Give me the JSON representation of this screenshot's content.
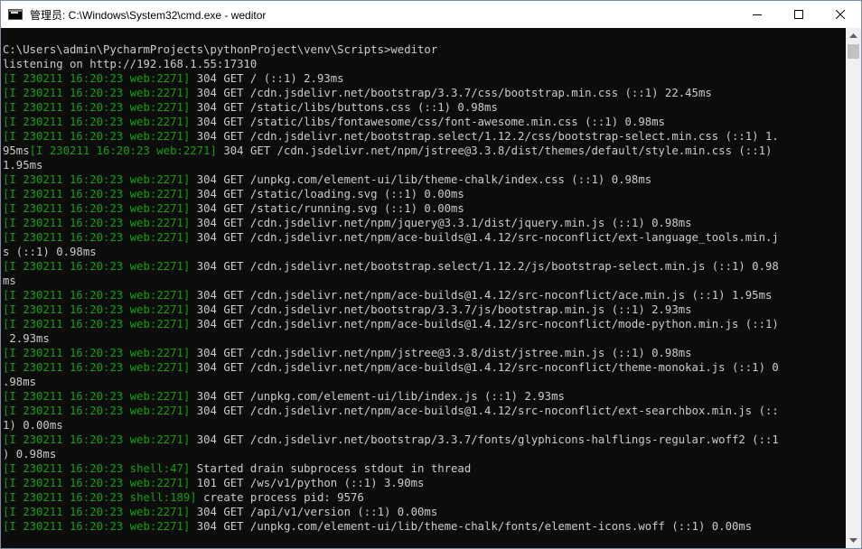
{
  "window": {
    "title": "管理员: C:\\Windows\\System32\\cmd.exe - weditor",
    "icon": "cmd-console-icon"
  },
  "console": {
    "lines": [
      [
        {
          "t": "C:\\Users\\admin\\PycharmProjects\\pythonProject\\venv\\Scripts>weditor"
        }
      ],
      [
        {
          "t": "listening on http://192.168.1.55:17310"
        }
      ],
      [
        {
          "t": "[I 230211 16:20:23 web:2271]",
          "g": true
        },
        {
          "t": " 304 GET / (::1) 2.93ms"
        }
      ],
      [
        {
          "t": "[I 230211 16:20:23 web:2271]",
          "g": true
        },
        {
          "t": " 304 GET /cdn.jsdelivr.net/bootstrap/3.3.7/css/bootstrap.min.css (::1) 22.45ms"
        }
      ],
      [
        {
          "t": "[I 230211 16:20:23 web:2271]",
          "g": true
        },
        {
          "t": " 304 GET /static/libs/buttons.css (::1) 0.98ms"
        }
      ],
      [
        {
          "t": "[I 230211 16:20:23 web:2271]",
          "g": true
        },
        {
          "t": " 304 GET /static/libs/fontawesome/css/font-awesome.min.css (::1) 0.98ms"
        }
      ],
      [
        {
          "t": "[I 230211 16:20:23 web:2271]",
          "g": true
        },
        {
          "t": " 304 GET /cdn.jsdelivr.net/bootstrap.select/1.12.2/css/bootstrap-select.min.css (::1) 1."
        }
      ],
      [
        {
          "t": "95ms"
        },
        {
          "t": "[I 230211 16:20:23 web:2271]",
          "g": true
        },
        {
          "t": " 304 GET /cdn.jsdelivr.net/npm/jstree@3.3.8/dist/themes/default/style.min.css (::1)"
        }
      ],
      [
        {
          "t": "1.95ms"
        }
      ],
      [
        {
          "t": "[I 230211 16:20:23 web:2271]",
          "g": true
        },
        {
          "t": " 304 GET /unpkg.com/element-ui/lib/theme-chalk/index.css (::1) 0.98ms"
        }
      ],
      [
        {
          "t": "[I 230211 16:20:23 web:2271]",
          "g": true
        },
        {
          "t": " 304 GET /static/loading.svg (::1) 0.00ms"
        }
      ],
      [
        {
          "t": "[I 230211 16:20:23 web:2271]",
          "g": true
        },
        {
          "t": " 304 GET /static/running.svg (::1) 0.00ms"
        }
      ],
      [
        {
          "t": "[I 230211 16:20:23 web:2271]",
          "g": true
        },
        {
          "t": " 304 GET /cdn.jsdelivr.net/npm/jquery@3.3.1/dist/jquery.min.js (::1) 0.98ms"
        }
      ],
      [
        {
          "t": "[I 230211 16:20:23 web:2271]",
          "g": true
        },
        {
          "t": " 304 GET /cdn.jsdelivr.net/npm/ace-builds@1.4.12/src-noconflict/ext-language_tools.min.j"
        }
      ],
      [
        {
          "t": "s (::1) 0.98ms"
        }
      ],
      [
        {
          "t": "[I 230211 16:20:23 web:2271]",
          "g": true
        },
        {
          "t": " 304 GET /cdn.jsdelivr.net/bootstrap.select/1.12.2/js/bootstrap-select.min.js (::1) 0.98"
        }
      ],
      [
        {
          "t": "ms"
        }
      ],
      [
        {
          "t": "[I 230211 16:20:23 web:2271]",
          "g": true
        },
        {
          "t": " 304 GET /cdn.jsdelivr.net/npm/ace-builds@1.4.12/src-noconflict/ace.min.js (::1) 1.95ms"
        }
      ],
      [
        {
          "t": "[I 230211 16:20:23 web:2271]",
          "g": true
        },
        {
          "t": " 304 GET /cdn.jsdelivr.net/bootstrap/3.3.7/js/bootstrap.min.js (::1) 2.93ms"
        }
      ],
      [
        {
          "t": "[I 230211 16:20:23 web:2271]",
          "g": true
        },
        {
          "t": " 304 GET /cdn.jsdelivr.net/npm/ace-builds@1.4.12/src-noconflict/mode-python.min.js (::1)"
        }
      ],
      [
        {
          "t": " 2.93ms"
        }
      ],
      [
        {
          "t": "[I 230211 16:20:23 web:2271]",
          "g": true
        },
        {
          "t": " 304 GET /cdn.jsdelivr.net/npm/jstree@3.3.8/dist/jstree.min.js (::1) 0.98ms"
        }
      ],
      [
        {
          "t": "[I 230211 16:20:23 web:2271]",
          "g": true
        },
        {
          "t": " 304 GET /cdn.jsdelivr.net/npm/ace-builds@1.4.12/src-noconflict/theme-monokai.js (::1) 0"
        }
      ],
      [
        {
          "t": ".98ms"
        }
      ],
      [
        {
          "t": "[I 230211 16:20:23 web:2271]",
          "g": true
        },
        {
          "t": " 304 GET /unpkg.com/element-ui/lib/index.js (::1) 2.93ms"
        }
      ],
      [
        {
          "t": "[I 230211 16:20:23 web:2271]",
          "g": true
        },
        {
          "t": " 304 GET /cdn.jsdelivr.net/npm/ace-builds@1.4.12/src-noconflict/ext-searchbox.min.js (::"
        }
      ],
      [
        {
          "t": "1) 0.00ms"
        }
      ],
      [
        {
          "t": "[I 230211 16:20:23 web:2271]",
          "g": true
        },
        {
          "t": " 304 GET /cdn.jsdelivr.net/bootstrap/3.3.7/fonts/glyphicons-halflings-regular.woff2 (::1"
        }
      ],
      [
        {
          "t": ") 0.98ms"
        }
      ],
      [
        {
          "t": "[I 230211 16:20:23 shell:47]",
          "g": true
        },
        {
          "t": " Started drain subprocess stdout in thread"
        }
      ],
      [
        {
          "t": "[I 230211 16:20:23 web:2271]",
          "g": true
        },
        {
          "t": " 101 GET /ws/v1/python (::1) 3.90ms"
        }
      ],
      [
        {
          "t": "[I 230211 16:20:23 shell:189]",
          "g": true
        },
        {
          "t": " create process pid: 9576"
        }
      ],
      [
        {
          "t": "[I 230211 16:20:23 web:2271]",
          "g": true
        },
        {
          "t": " 304 GET /api/v1/version (::1) 0.00ms"
        }
      ],
      [
        {
          "t": "[I 230211 16:20:23 web:2271]",
          "g": true
        },
        {
          "t": " 304 GET /unpkg.com/element-ui/lib/theme-chalk/fonts/element-icons.woff (::1) 0.00ms"
        }
      ]
    ]
  },
  "colors": {
    "background": "#0c0c0c",
    "text": "#cccccc",
    "log_prefix": "#13a10e"
  },
  "icons": {
    "minimize": "minimize-icon",
    "maximize": "maximize-icon",
    "close": "close-icon",
    "scroll_up": "scroll-up-arrow-icon",
    "scroll_down": "scroll-down-arrow-icon"
  }
}
